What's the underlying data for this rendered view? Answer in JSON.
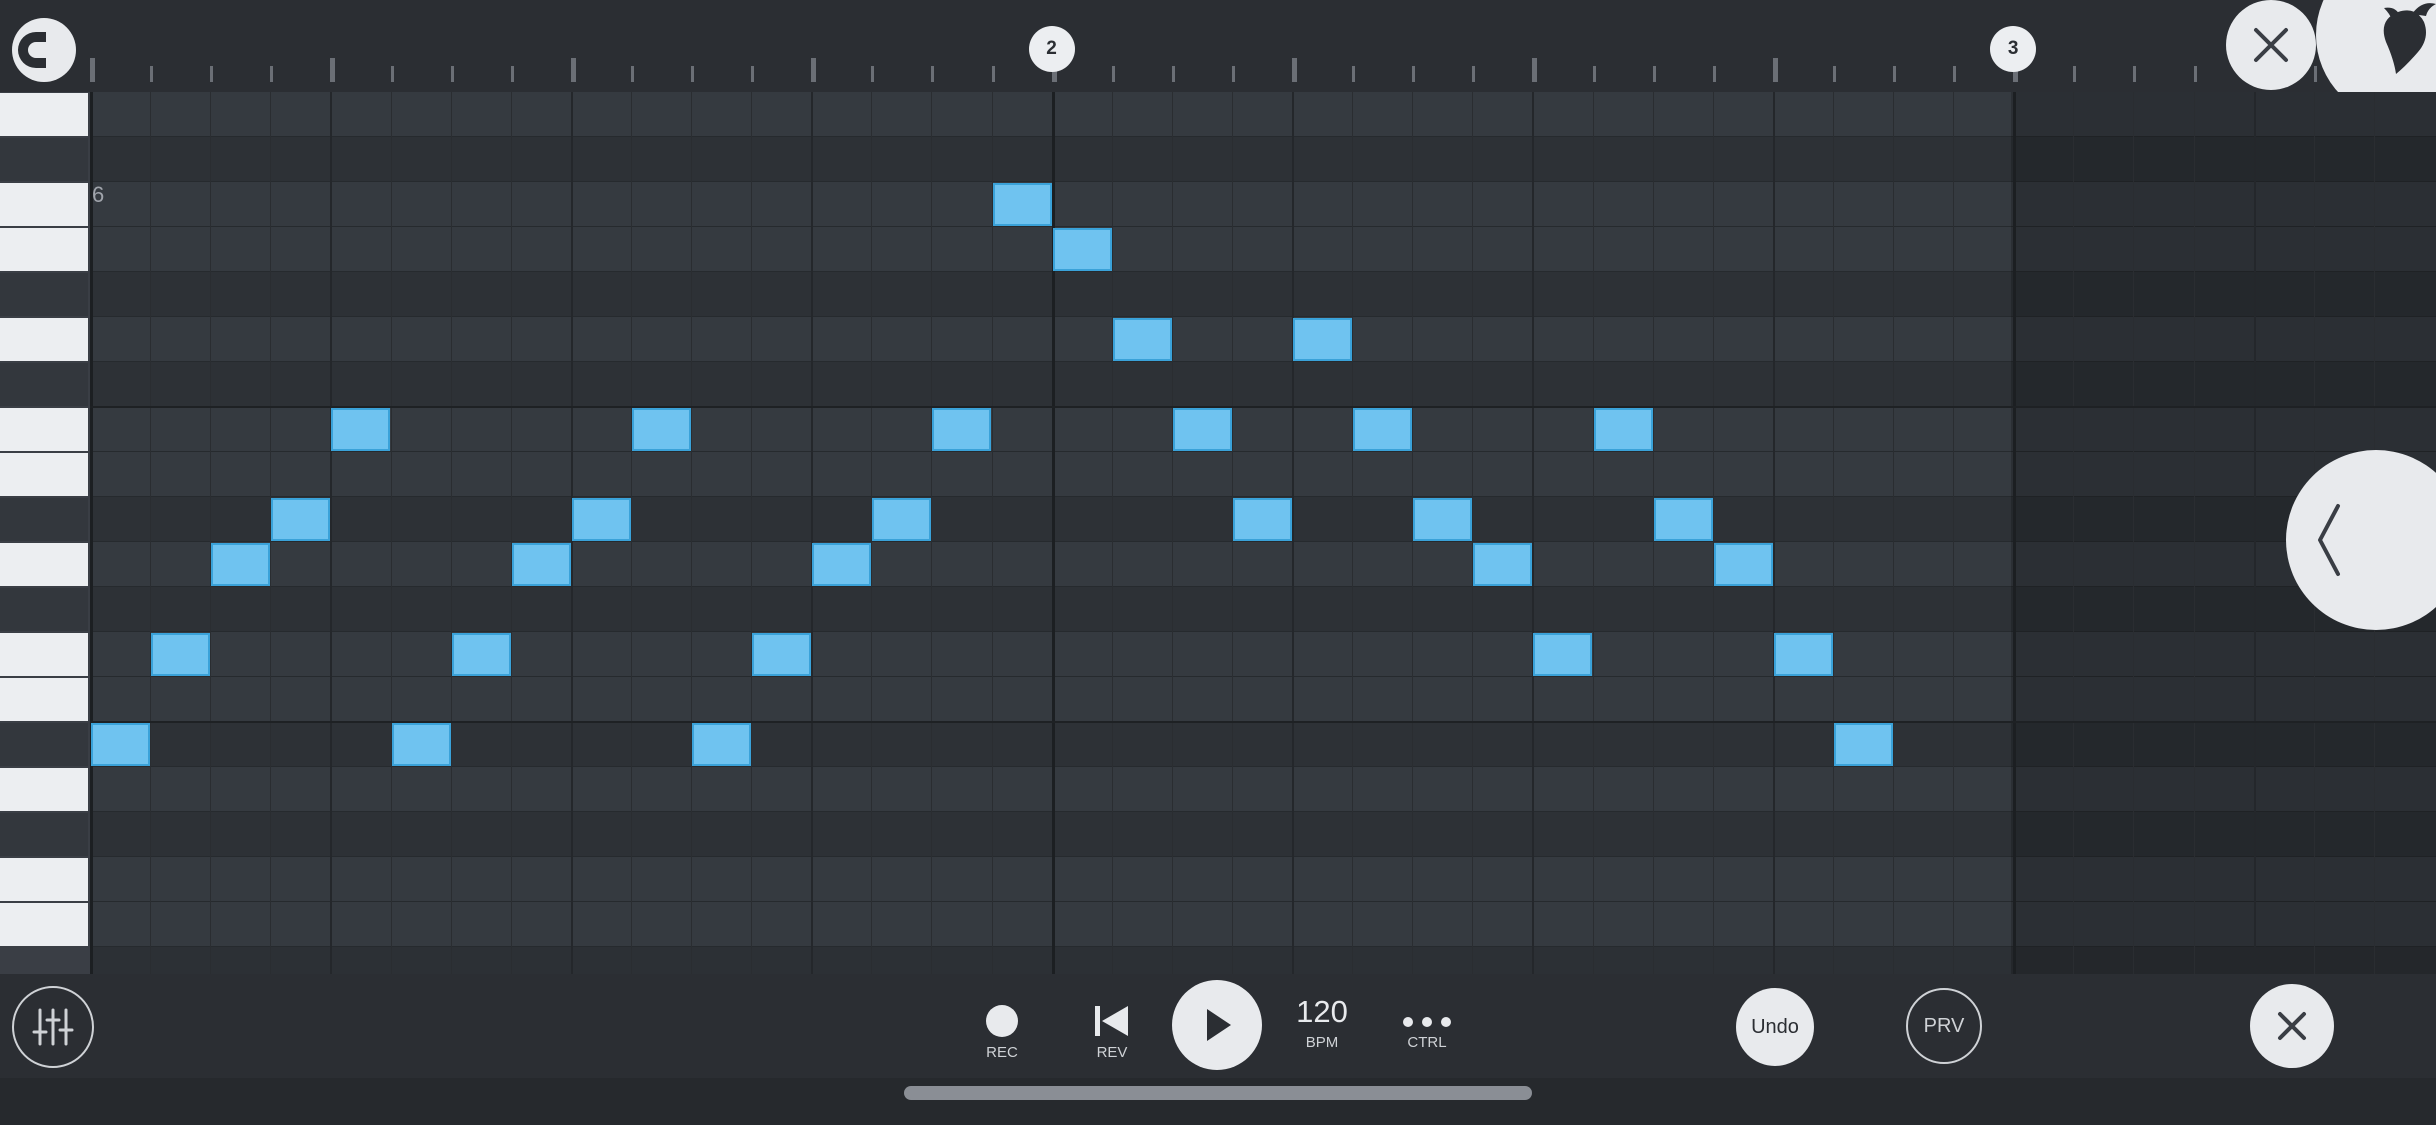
{
  "ruler": {
    "markers": [
      {
        "label": "2",
        "bar": 2
      },
      {
        "label": "3",
        "bar": 3
      }
    ]
  },
  "piano": {
    "octave_label": "6"
  },
  "piano_roll": {
    "beats_per_bar": 4,
    "steps_per_beat": 4,
    "visible_steps": 38,
    "visible_rows": 19,
    "notes": [
      {
        "step": 0,
        "row": 14
      },
      {
        "step": 1,
        "row": 12
      },
      {
        "step": 2,
        "row": 10
      },
      {
        "step": 3,
        "row": 9
      },
      {
        "step": 4,
        "row": 7
      },
      {
        "step": 5,
        "row": 14
      },
      {
        "step": 6,
        "row": 12
      },
      {
        "step": 7,
        "row": 10
      },
      {
        "step": 8,
        "row": 9
      },
      {
        "step": 9,
        "row": 7
      },
      {
        "step": 10,
        "row": 14
      },
      {
        "step": 11,
        "row": 12
      },
      {
        "step": 12,
        "row": 10
      },
      {
        "step": 13,
        "row": 9
      },
      {
        "step": 14,
        "row": 7
      },
      {
        "step": 15,
        "row": 2
      },
      {
        "step": 16,
        "row": 3
      },
      {
        "step": 17,
        "row": 5
      },
      {
        "step": 18,
        "row": 7
      },
      {
        "step": 19,
        "row": 9
      },
      {
        "step": 20,
        "row": 5
      },
      {
        "step": 21,
        "row": 7
      },
      {
        "step": 22,
        "row": 9
      },
      {
        "step": 23,
        "row": 10
      },
      {
        "step": 24,
        "row": 12
      },
      {
        "step": 25,
        "row": 7
      },
      {
        "step": 26,
        "row": 9
      },
      {
        "step": 27,
        "row": 10
      },
      {
        "step": 28,
        "row": 12
      },
      {
        "step": 29,
        "row": 14
      }
    ]
  },
  "transport": {
    "rec_label": "REC",
    "rev_label": "REV",
    "bpm_value": "120",
    "bpm_label": "BPM",
    "ctrl_label": "CTRL",
    "undo_label": "Undo",
    "prv_label": "PRV"
  },
  "colors": {
    "note_fill": "#6fc3f0",
    "accent_light": "#e8eaed",
    "background": "#2f3339"
  },
  "icons": {
    "magnet": "magnet-icon",
    "close": "close-icon",
    "logo": "fruit-logo-icon",
    "collapse": "chevron-left-icon",
    "mixer": "mixer-sliders-icon",
    "record": "record-icon",
    "rewind": "skip-back-icon",
    "play": "play-icon",
    "more": "more-dots-icon"
  }
}
